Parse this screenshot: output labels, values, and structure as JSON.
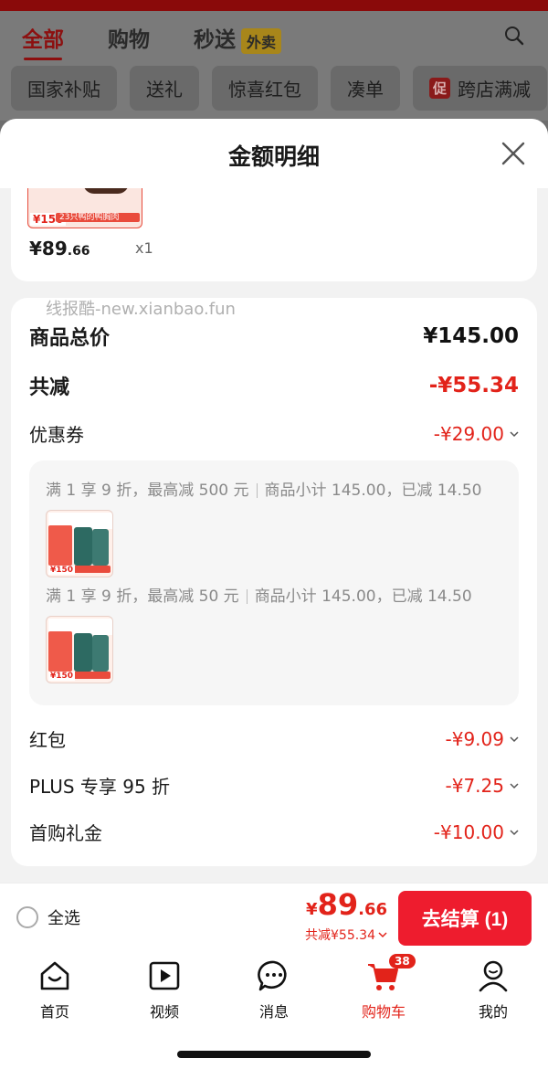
{
  "background": {
    "tabs": [
      {
        "label": "全部",
        "active": true
      },
      {
        "label": "购物",
        "active": false
      },
      {
        "label": "秒送",
        "active": false,
        "badge": "外卖"
      }
    ],
    "chips": [
      "国家补贴",
      "送礼",
      "惊喜红包",
      "凑单"
    ],
    "promo_chip": {
      "badge": "促",
      "label": "跨店满减"
    }
  },
  "sheet": {
    "title": "金额明细",
    "top_item": {
      "price_main": "¥89",
      "price_dec": ".66",
      "qty": "x1",
      "thumb_price": "¥150",
      "thumb_text": "23只鸭的鸭胸肉"
    },
    "watermark": "线报酷-new.xianbao.fun",
    "rows": {
      "total": {
        "label": "商品总价",
        "value": "¥145.00"
      },
      "reduce": {
        "label": "共减",
        "value": "-¥55.34"
      },
      "coupon": {
        "label": "优惠券",
        "value": "-¥29.00"
      },
      "hongbao": {
        "label": "红包",
        "value": "-¥9.09"
      },
      "plus": {
        "label": "PLUS 专享 95 折",
        "value": "-¥7.25"
      },
      "first": {
        "label": "首购礼金",
        "value": "-¥10.00"
      }
    },
    "coupons": [
      {
        "rule": "满 1 享 9 折，最高减 500 元",
        "detail": "商品小计 145.00，已减 14.50",
        "thumb_price": "¥150"
      },
      {
        "rule": "满 1 享 9 折，最高减 50 元",
        "detail": "商品小计 145.00，已减 14.50",
        "thumb_price": "¥150"
      }
    ]
  },
  "checkout": {
    "select_all": "全选",
    "yen": "¥",
    "price_int": "89",
    "price_dec": ".66",
    "saved": "共减¥55.34",
    "button": "去结算 (1)"
  },
  "tabbar": {
    "items": [
      {
        "label": "首页",
        "icon": "home-icon"
      },
      {
        "label": "视频",
        "icon": "video-icon"
      },
      {
        "label": "消息",
        "icon": "message-icon"
      },
      {
        "label": "购物车",
        "icon": "cart-icon",
        "badge": "38",
        "active": true
      },
      {
        "label": "我的",
        "icon": "profile-icon"
      }
    ]
  },
  "colors": {
    "accent": "#e2231a",
    "button": "#ee1c2e"
  }
}
